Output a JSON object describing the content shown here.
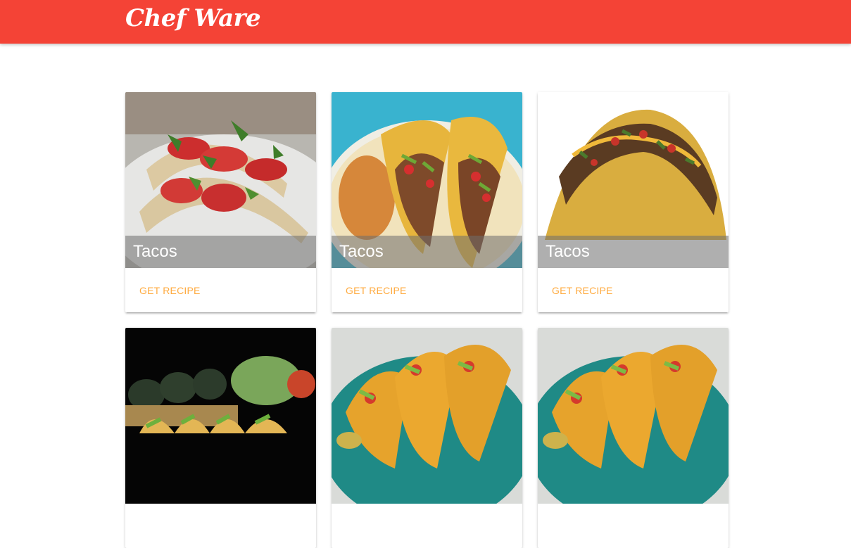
{
  "navbar": {
    "brand": "Chef Ware",
    "color": "#f44336"
  },
  "cards": [
    {
      "title": "Tacos",
      "action": "GET RECIPE",
      "image": "soft-tacos-tomato-cilantro-photo"
    },
    {
      "title": "Tacos",
      "action": "GET RECIPE",
      "image": "crispy-tacos-with-rice-plate-photo"
    },
    {
      "title": "Tacos",
      "action": "GET RECIPE",
      "image": "single-hard-shell-taco-photo"
    },
    {
      "title": "",
      "action": "",
      "image": "taco-basket-black-background-photo"
    },
    {
      "title": "",
      "action": "",
      "image": "tacos-teal-plate-photo"
    },
    {
      "title": "",
      "action": "",
      "image": "tacos-teal-plate-photo"
    }
  ],
  "accent": "#ffab40"
}
